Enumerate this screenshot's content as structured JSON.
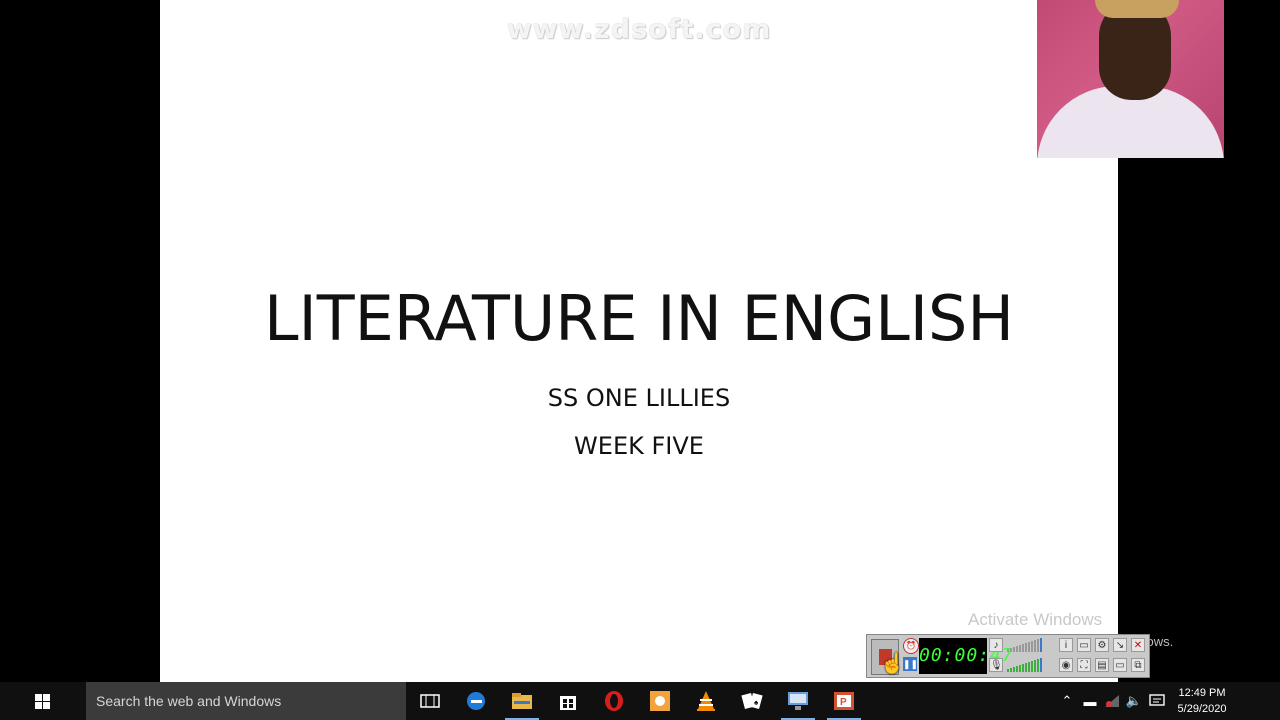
{
  "watermark": "www.zdsoft.com",
  "slide": {
    "title": "LITERATURE IN ENGLISH",
    "subtitle_1": "SS ONE LILLIES",
    "subtitle_2": "WEEK FIVE"
  },
  "activation": {
    "line1": "Activate Windows",
    "line2": "Go to Settings to activate Windows."
  },
  "recorder": {
    "timer": "00:00:47"
  },
  "taskbar": {
    "search_placeholder": "Search the web and Windows",
    "apps": [
      "task-view",
      "edge",
      "file-explorer",
      "store",
      "opera",
      "paint",
      "vlc",
      "solitaire",
      "remote-desktop",
      "powerpoint"
    ],
    "clock_time": "12:49 PM",
    "clock_date": "5/29/2020"
  },
  "colors": {
    "slide_bg": "#ffffff",
    "desktop_bg": "#000000",
    "taskbar_bg": "#101010",
    "search_bg": "#3b3b3b",
    "timer_green": "#3cff3c"
  }
}
